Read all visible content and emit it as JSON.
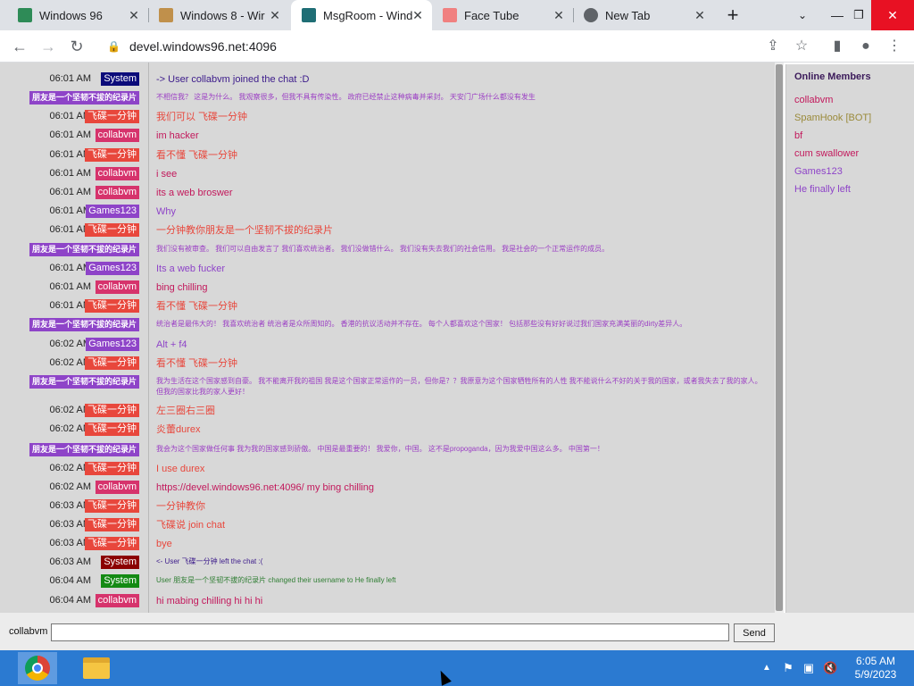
{
  "browser": {
    "tabs": [
      {
        "title": "Windows 96",
        "favicon_color": "#2e8b57"
      },
      {
        "title": "Windows 8 - Wir",
        "favicon_color": "#c0904b"
      },
      {
        "title": "MsgRoom - Wind",
        "favicon_color": "#1f6e75"
      },
      {
        "title": "Face Tube",
        "favicon_color": "#f08080"
      },
      {
        "title": "New Tab",
        "favicon_color": "#5f6368"
      }
    ],
    "new_tab_icon": "+",
    "url": "devel.windows96.net:4096"
  },
  "chat": {
    "messages": [
      {
        "time": "06:01 AM",
        "user": "System",
        "user_color": "#0b0b7a",
        "text": "-> User collabvm joined the chat :D",
        "text_color": "#3b1a8a"
      },
      {
        "time": "06:01 AM",
        "user": "朋友是一个坚韧不拔的纪录片",
        "user_color": "#8e44c8",
        "text": "不相信我？ 这是为什么。 我观察很多，但我不具有传染性。 政府已经禁止这种病毒并采封。 天安门广场什么都没有发生",
        "text_color": "#9b3fc4"
      },
      {
        "time": "06:01 AM",
        "user": "飞碟一分钟",
        "user_color": "#e8473c",
        "text": "我们可以 飞碟一分钟",
        "text_color": "#e8473c"
      },
      {
        "time": "06:01 AM",
        "user": "collabvm",
        "user_color": "#d6336c",
        "text": "im hacker",
        "text_color": "#c2185b"
      },
      {
        "time": "06:01 AM",
        "user": "飞碟一分钟",
        "user_color": "#e8473c",
        "text": "看不懂 飞碟一分钟",
        "text_color": "#e8473c"
      },
      {
        "time": "06:01 AM",
        "user": "collabvm",
        "user_color": "#d6336c",
        "text": "i see",
        "text_color": "#c2185b"
      },
      {
        "time": "06:01 AM",
        "user": "collabvm",
        "user_color": "#d6336c",
        "text": "its a web broswer",
        "text_color": "#c2185b"
      },
      {
        "time": "06:01 AM",
        "user": "Games123",
        "user_color": "#8e44c8",
        "text": "Why",
        "text_color": "#8e44c8"
      },
      {
        "time": "06:01 AM",
        "user": "飞碟一分钟",
        "user_color": "#e8473c",
        "text": "一分钟教你朋友是一个坚韧不拔的纪录片",
        "text_color": "#e8473c"
      },
      {
        "time": "06:01 AM",
        "user": "朋友是一个坚韧不拔的纪录片",
        "user_color": "#8e44c8",
        "text": "我们没有被审查。 我们可以自由发言了 我们喜欢统治者。 我们没做错什么。 我们没有失去我们的社会信用。 我是社会的一个正常运作的成员。",
        "text_color": "#9b3fc4"
      },
      {
        "time": "06:01 AM",
        "user": "Games123",
        "user_color": "#8e44c8",
        "text": "Its a web fucker",
        "text_color": "#8e44c8"
      },
      {
        "time": "06:01 AM",
        "user": "collabvm",
        "user_color": "#d6336c",
        "text": "bing chilling",
        "text_color": "#c2185b"
      },
      {
        "time": "06:01 AM",
        "user": "飞碟一分钟",
        "user_color": "#e8473c",
        "text": "看不懂 飞碟一分钟",
        "text_color": "#e8473c"
      },
      {
        "time": "06:02 AM",
        "user": "朋友是一个坚韧不拔的纪录片",
        "user_color": "#8e44c8",
        "text": "统治者是最伟大的！ 我喜欢统治者 统治者是众所周知的。 香港的抗议活动并不存在。 每个人都喜欢这个国家！ 包括那些没有好好说过我们国家充满美丽的dirty差异人。",
        "text_color": "#9b3fc4"
      },
      {
        "time": "06:02 AM",
        "user": "Games123",
        "user_color": "#8e44c8",
        "text": "Alt + f4",
        "text_color": "#8e44c8"
      },
      {
        "time": "06:02 AM",
        "user": "飞碟一分钟",
        "user_color": "#e8473c",
        "text": "看不懂 飞碟一分钟",
        "text_color": "#e8473c"
      },
      {
        "time": "06:02 AM",
        "user": "朋友是一个坚韧不拔的纪录片",
        "user_color": "#8e44c8",
        "text": "我为生活在这个国家感到自豪。 我不能离开我的祖国 我是这个国家正常运作的一员，但你是？？我原意为这个国家牺牲所有的人性 我不能说什么不好的关于我的国家，或者我失去了我的家人。 但我的国家比我的家人更好！",
        "text_color": "#9b3fc4"
      },
      {
        "time": "06:02 AM",
        "user": "飞碟一分钟",
        "user_color": "#e8473c",
        "text": "左三圈右三圈",
        "text_color": "#e8473c"
      },
      {
        "time": "06:02 AM",
        "user": "飞碟一分钟",
        "user_color": "#e8473c",
        "text": "炎蕾durex",
        "text_color": "#e8473c"
      },
      {
        "time": "06:02 AM",
        "user": "朋友是一个坚韧不拔的纪录片",
        "user_color": "#8e44c8",
        "text": "我会为这个国家做任何事 我为我的国家感到骄傲。 中国是最重要的！ 我爱你，中国。 这不是propoganda，因为我爱中国这么多。 中国第一！",
        "text_color": "#9b3fc4"
      },
      {
        "time": "06:02 AM",
        "user": "飞碟一分钟",
        "user_color": "#e8473c",
        "text": "I use durex",
        "text_color": "#e8473c"
      },
      {
        "time": "06:02 AM",
        "user": "collabvm",
        "user_color": "#d6336c",
        "text": "https://devel.windows96.net:4096/ my bing chilling",
        "text_color": "#c2185b"
      },
      {
        "time": "06:03 AM",
        "user": "飞碟一分钟",
        "user_color": "#e8473c",
        "text": "一分钟教你",
        "text_color": "#e8473c"
      },
      {
        "time": "06:03 AM",
        "user": "飞碟一分钟",
        "user_color": "#e8473c",
        "text": "飞碟说 join chat",
        "text_color": "#e8473c"
      },
      {
        "time": "06:03 AM",
        "user": "飞碟一分钟",
        "user_color": "#e8473c",
        "text": "bye",
        "text_color": "#e8473c"
      },
      {
        "time": "06:03 AM",
        "user": "System",
        "user_color": "#8b0000",
        "text": "<- User 飞碟一分钟 left the chat :(",
        "text_color": "#3b1a8a"
      },
      {
        "time": "06:04 AM",
        "user": "System",
        "user_color": "#138a13",
        "text": "User 朋友是一个坚韧不拔的纪录片 changed their username to He finally left",
        "text_color": "#2e7d32"
      },
      {
        "time": "06:04 AM",
        "user": "collabvm",
        "user_color": "#d6336c",
        "text": "hi mabing chilling hi hi hi",
        "text_color": "#c2185b"
      }
    ]
  },
  "members": {
    "title": "Online Members",
    "list": [
      {
        "name": "collabvm",
        "color": "#c2185b"
      },
      {
        "name": "SpamHook [BOT]",
        "color": "#9a8a3a"
      },
      {
        "name": "bf",
        "color": "#c2185b"
      },
      {
        "name": "cum swallower",
        "color": "#c2185b"
      },
      {
        "name": "Games123",
        "color": "#8e44c8"
      },
      {
        "name": "He finally left",
        "color": "#8e44c8"
      }
    ]
  },
  "input": {
    "username": "collabvm",
    "value": "",
    "send_label": "Send"
  },
  "taskbar": {
    "time": "6:05 AM",
    "date": "5/9/2023"
  }
}
